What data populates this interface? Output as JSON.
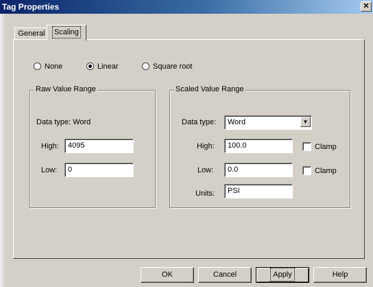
{
  "window": {
    "title": "Tag Properties",
    "close_glyph": "✕"
  },
  "tabs": [
    {
      "label": "General",
      "active": false
    },
    {
      "label": "Scaling",
      "active": true
    }
  ],
  "scaling_mode": {
    "options": [
      {
        "label": "None",
        "selected": false
      },
      {
        "label": "Linear",
        "selected": true
      },
      {
        "label": "Square root",
        "selected": false
      }
    ]
  },
  "raw_range": {
    "legend": "Raw Value Range",
    "data_type_text": "Data type: Word",
    "high_label": "High:",
    "high_value": "4095",
    "low_label": "Low:",
    "low_value": "0"
  },
  "scaled_range": {
    "legend": "Scaled Value Range",
    "data_type_label": "Data type:",
    "data_type_value": "Word",
    "high_label": "High:",
    "high_value": "100.0",
    "low_label": "Low:",
    "low_value": "0.0",
    "units_label": "Units:",
    "units_value": "PSI",
    "clamp_high_label": "Clamp",
    "clamp_high_checked": false,
    "clamp_low_label": "Clamp",
    "clamp_low_checked": false
  },
  "buttons": {
    "ok": "OK",
    "cancel": "Cancel",
    "apply": "Apply",
    "help": "Help"
  }
}
